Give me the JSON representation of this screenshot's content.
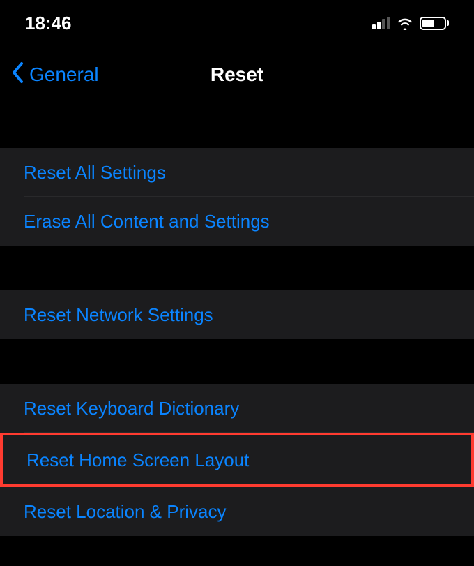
{
  "statusBar": {
    "time": "18:46"
  },
  "nav": {
    "backLabel": "General",
    "title": "Reset"
  },
  "groups": [
    {
      "items": [
        {
          "label": "Reset All Settings"
        },
        {
          "label": "Erase All Content and Settings"
        }
      ]
    },
    {
      "items": [
        {
          "label": "Reset Network Settings"
        }
      ]
    },
    {
      "items": [
        {
          "label": "Reset Keyboard Dictionary"
        },
        {
          "label": "Reset Home Screen Layout",
          "highlighted": true
        },
        {
          "label": "Reset Location & Privacy"
        }
      ]
    }
  ]
}
